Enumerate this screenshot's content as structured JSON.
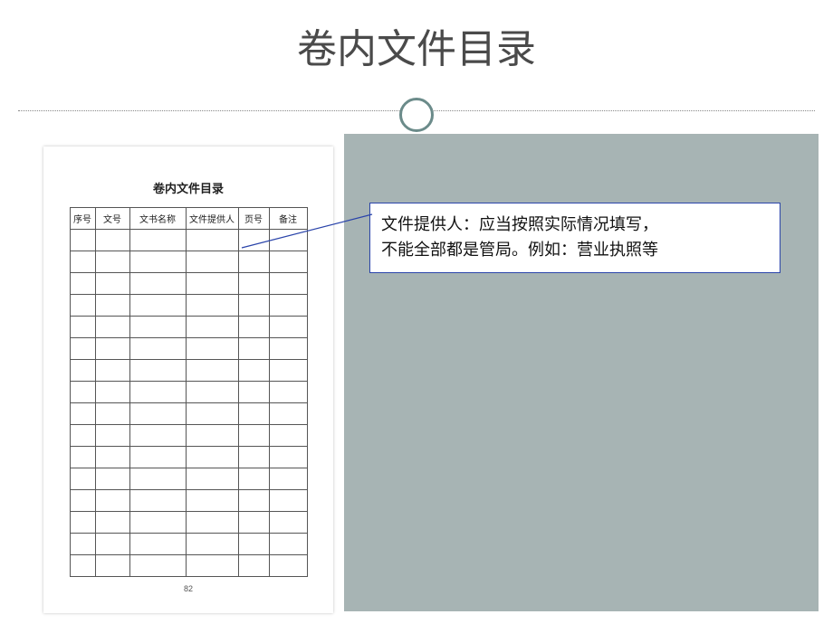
{
  "slide": {
    "title": "卷内文件目录"
  },
  "document": {
    "title": "卷内文件目录",
    "headers": [
      "序号",
      "文号",
      "文书名称",
      "文件提供人",
      "页号",
      "备注"
    ],
    "page_number": "82"
  },
  "note": {
    "line1": "文件提供人：应当按照实际情况填写，",
    "line2": "不能全部都是管局。例如：营业执照等"
  }
}
